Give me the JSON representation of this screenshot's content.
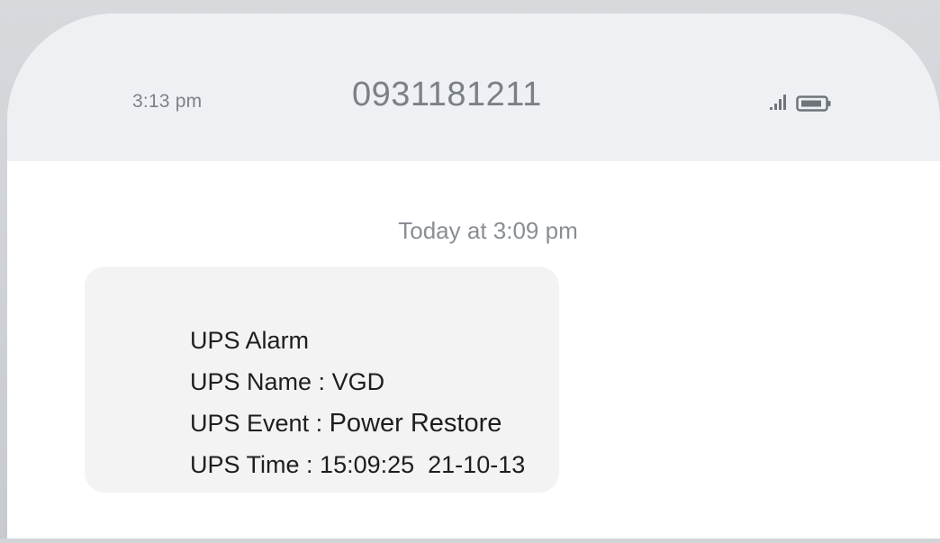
{
  "status_bar": {
    "time": "3:13 pm",
    "contact_number": "0931181211",
    "signal_icon": "signal-icon",
    "battery_icon": "battery-icon"
  },
  "conversation": {
    "timestamp": "Today at 3:09 pm",
    "message": {
      "line1": "UPS Alarm",
      "line2_label": "UPS Name : ",
      "line2_value": "VGD",
      "line3_label": "UPS Event : ",
      "line3_value": "Power Restore",
      "line4_label": "UPS Time : ",
      "line4_value": "15:09:25  21-10-13"
    }
  },
  "colors": {
    "header_bg": "#eef0f4",
    "bubble_bg": "#f3f3f3",
    "muted_text": "#7b8087"
  }
}
